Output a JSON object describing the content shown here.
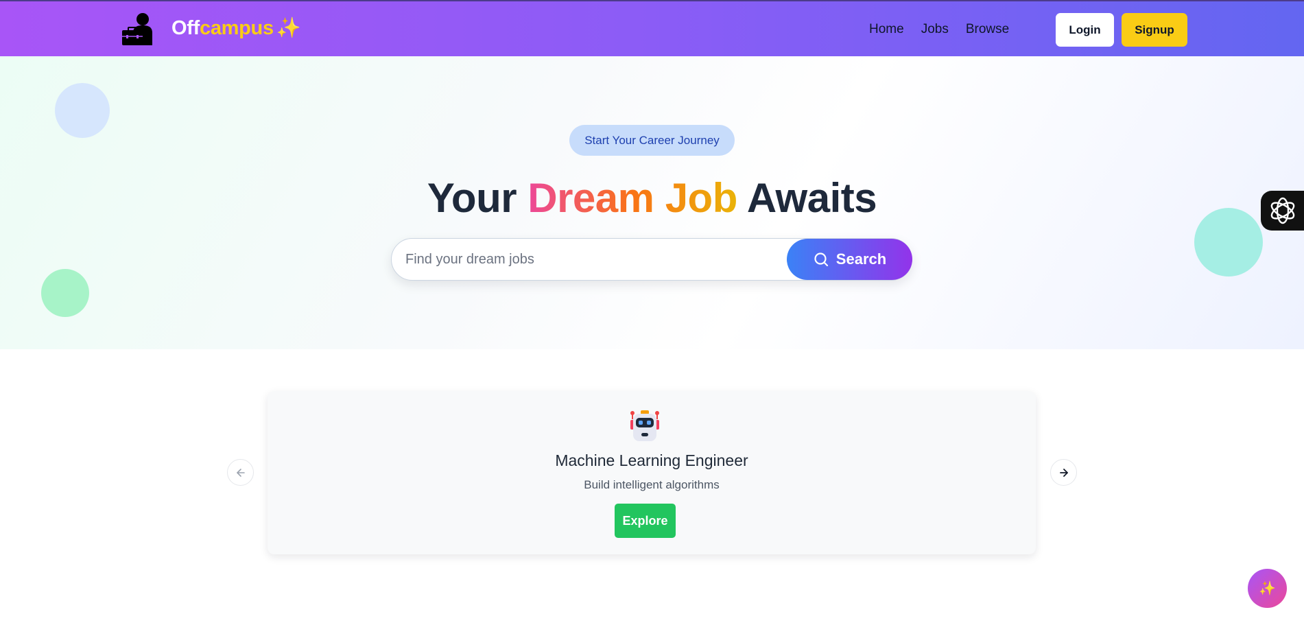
{
  "brand": {
    "part1": "Off",
    "part2": "campus",
    "spark": "✨"
  },
  "nav": {
    "links": [
      {
        "label": "Home"
      },
      {
        "label": "Jobs"
      },
      {
        "label": "Browse"
      }
    ]
  },
  "auth": {
    "login_label": "Login",
    "signup_label": "Signup"
  },
  "hero": {
    "badge": "Start Your Career Journey",
    "headline_part1": "Your",
    "headline_highlight": "Dream Job",
    "headline_part2": "Awaits",
    "search_placeholder": "Find your dream jobs",
    "search_button": "Search"
  },
  "carousel": {
    "current": {
      "icon": "robot-icon",
      "title": "Machine Learning Engineer",
      "subtitle": "Build intelligent algorithms",
      "button": "Explore"
    }
  },
  "fab": {
    "icon": "sparkles-icon",
    "glyph": "✨"
  },
  "colors": {
    "nav_gradient_start": "#a855f7",
    "nav_gradient_end": "#6366f1",
    "brand_accent": "#facc15",
    "search_gradient_start": "#3b82f6",
    "search_gradient_end": "#9333ea",
    "explore_green": "#22c55e"
  }
}
